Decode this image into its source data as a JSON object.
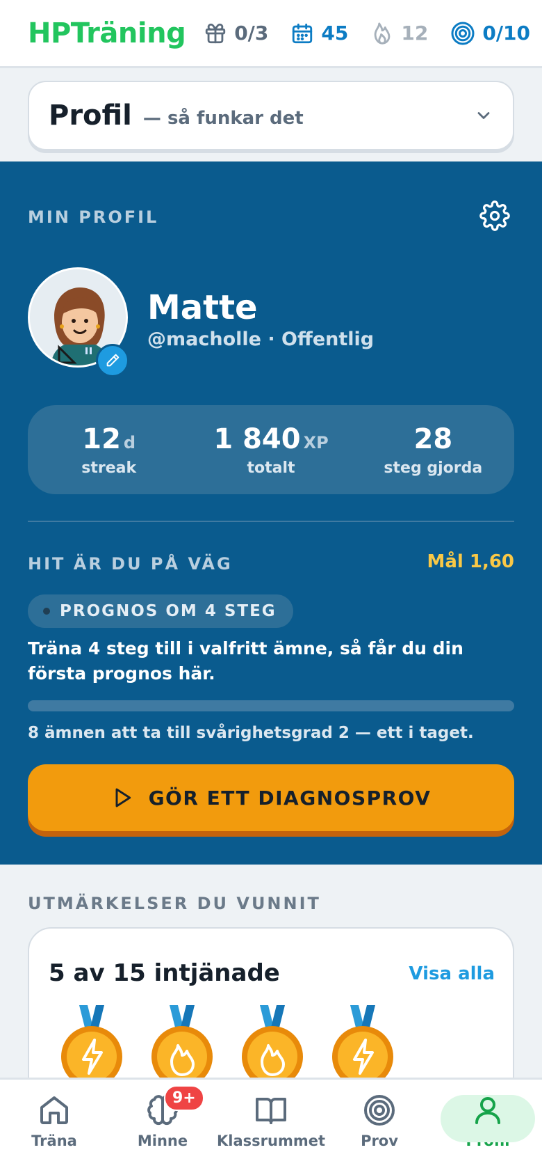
{
  "topbar": {
    "logo": "HPTräning",
    "gifts": "0/3",
    "calendar": "45",
    "streak": "12",
    "goal": "0/10",
    "icons": [
      "gift-icon",
      "calendar-icon",
      "flame-icon",
      "target-icon"
    ]
  },
  "guide": {
    "title": "Profil",
    "subtitle": "— så funkar det"
  },
  "profile": {
    "section_label": "MIN PROFIL",
    "name": "Matte",
    "handle": "@macholle · Offentlig",
    "stats": [
      {
        "value": "12",
        "unit": "d",
        "label": "streak"
      },
      {
        "value": "1 840",
        "unit": "XP",
        "label": "totalt"
      },
      {
        "value": "28",
        "unit": "",
        "label": "steg gjorda"
      }
    ]
  },
  "progress": {
    "section_label": "HIT ÄR DU PÅ VÄG",
    "goal": "Mål 1,60",
    "pill": "PROGNOS OM 4 STEG",
    "hint": "Träna 4 steg till i valfritt ämne, så får du din första prognos här.",
    "bar_fraction": 0,
    "subjects": "8 ämnen att ta till svårighetsgrad 2 — ett i taget.",
    "cta": "GÖR ETT DIAGNOSPROV"
  },
  "awards": {
    "section_label": "UTMÄRKELSER DU VUNNIT",
    "count": "5 av 15 intjänade",
    "show_all": "Visa alla",
    "medals": [
      "lightning-medal-icon",
      "flame-medal-icon",
      "flame-medal-icon",
      "lightning-medal-icon"
    ]
  },
  "nav": {
    "items": [
      {
        "label": "Träna",
        "icon": "home-icon"
      },
      {
        "label": "Minne",
        "icon": "brain-icon",
        "badge": "9+"
      },
      {
        "label": "Klassrummet",
        "icon": "book-icon"
      },
      {
        "label": "Prov",
        "icon": "target-icon"
      },
      {
        "label": "Profil",
        "icon": "user-icon",
        "active": true
      }
    ]
  },
  "colors": {
    "brand_green": "#22c55e",
    "panel_blue": "#0a5b8e",
    "accent_orange": "#f29b0d",
    "link_blue": "#1e9be0",
    "goal_yellow": "#f9c846"
  }
}
